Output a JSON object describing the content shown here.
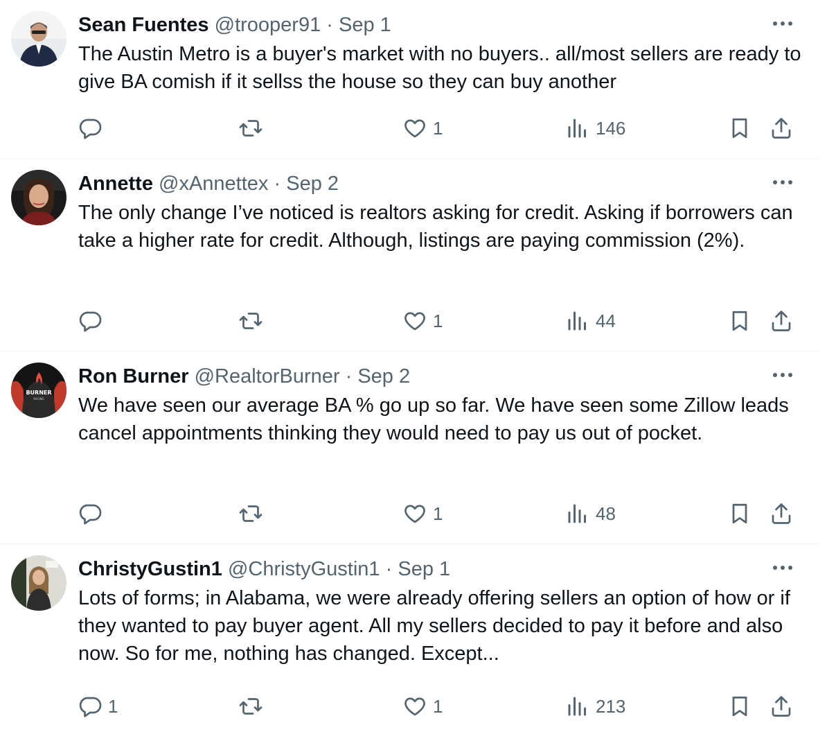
{
  "tweets": [
    {
      "name": "Sean Fuentes",
      "handle": "@trooper91",
      "separator": "·",
      "date": "Sep 1",
      "text": "The Austin Metro is a buyer's market with no buyers.. all/most sellers are ready to give BA comish if it sellss the house so they can buy another",
      "replies": "",
      "likes": "1",
      "views": "146"
    },
    {
      "name": "Annette",
      "handle": "@xAnnettex",
      "separator": "·",
      "date": "Sep 2",
      "text": "The only change I’ve noticed is realtors asking for credit. Asking if borrowers can take a higher rate for credit. Although, listings are paying commission (2%).",
      "replies": "",
      "likes": "1",
      "views": "44"
    },
    {
      "name": "Ron Burner",
      "handle": "@RealtorBurner",
      "separator": "·",
      "date": "Sep 2",
      "text": "We have seen our average BA % go up so far. We have seen some Zillow leads cancel appointments thinking they would need to pay us out of pocket.",
      "replies": "",
      "likes": "1",
      "views": "48"
    },
    {
      "name": "ChristyGustin1",
      "handle": "@ChristyGustin1",
      "separator": "·",
      "date": "Sep 1",
      "text": "Lots of forms; in Alabama, we were already offering sellers an option of how or if they wanted to pay buyer agent. All my sellers decided to pay it before and also now. So for me, nothing has changed. Except...",
      "replies": "1",
      "likes": "1",
      "views": "213"
    }
  ],
  "icons": {
    "reply": "reply-icon",
    "repost": "repost-icon",
    "like": "heart-icon",
    "views": "views-chart-icon",
    "bookmark": "bookmark-icon",
    "share": "share-icon",
    "more": "more-dots-icon"
  },
  "colors": {
    "text": "#0f1419",
    "secondary": "#536471",
    "divider": "#eff3f4"
  }
}
